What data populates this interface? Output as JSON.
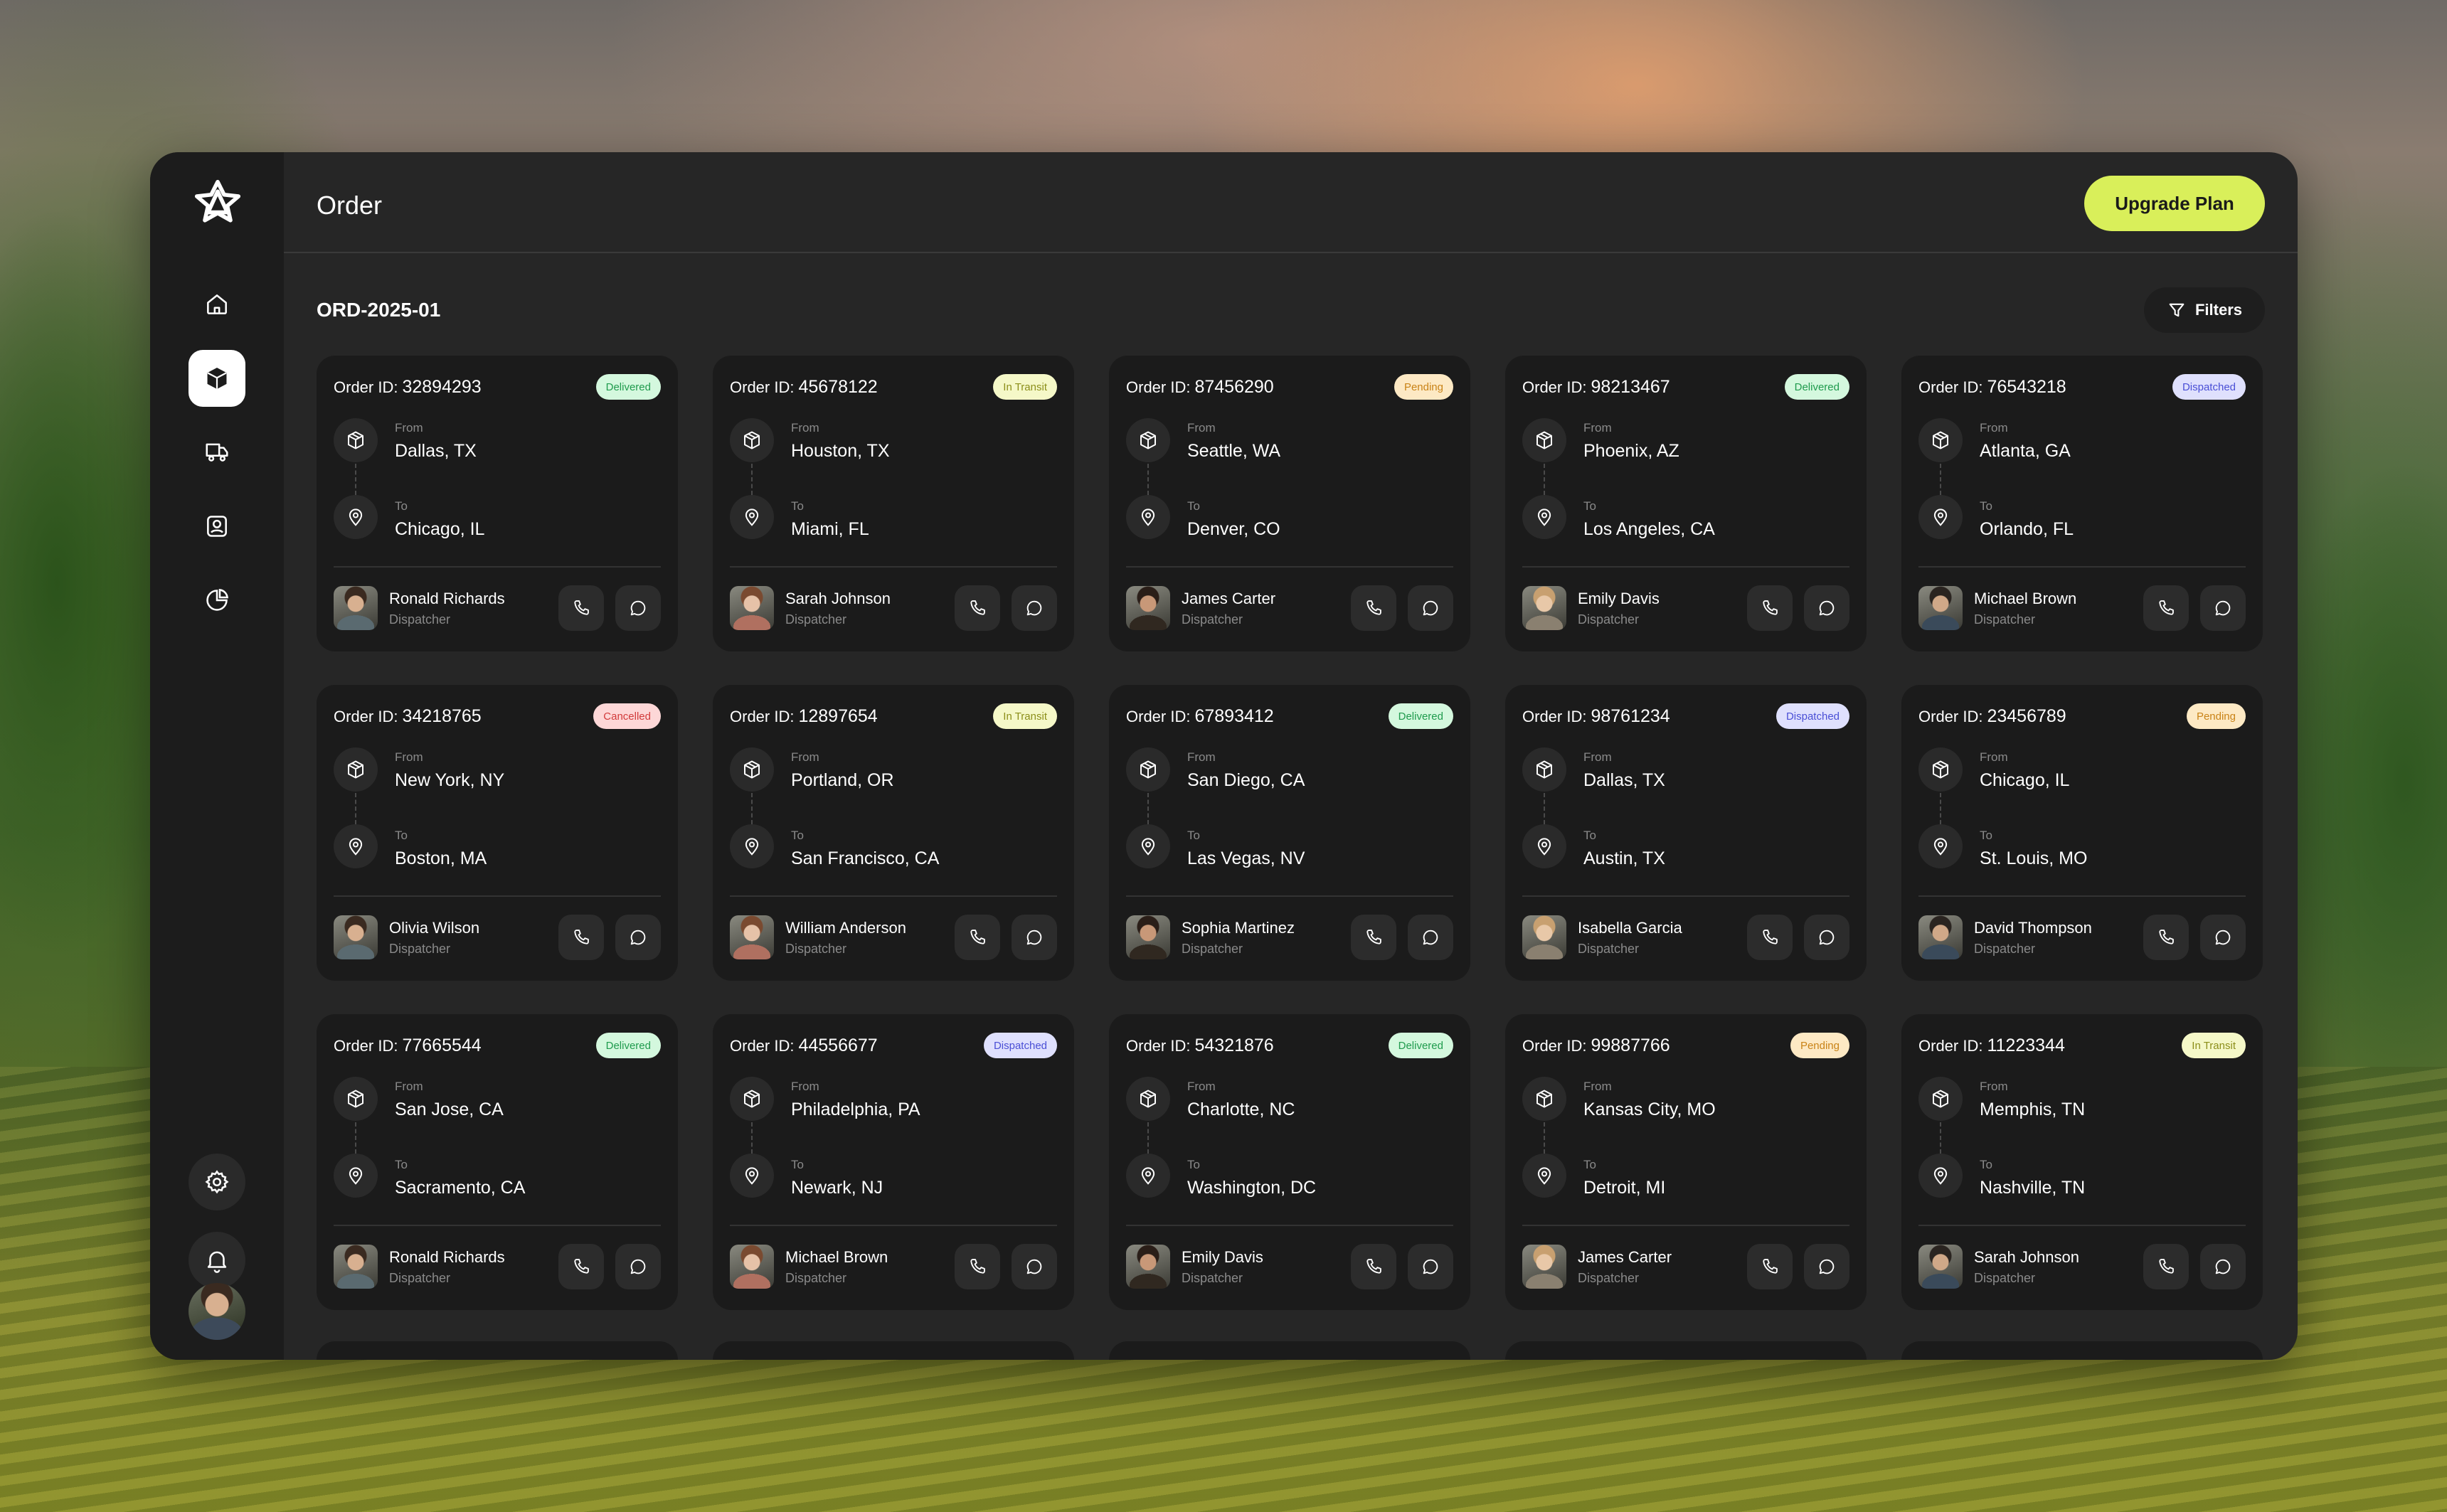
{
  "app": {
    "title": "Order"
  },
  "header": {
    "upgrade_label": "Upgrade Plan"
  },
  "toolbar": {
    "section_title": "ORD-2025-01",
    "filters_label": "Filters"
  },
  "labels": {
    "order_id": "Order ID:",
    "from": "From",
    "to": "To"
  },
  "status_colors": {
    "Delivered": "#1f9b4d",
    "In Transit": "#8c8f1a",
    "Pending": "#c98317",
    "Dispatched": "#4a4fd6",
    "Cancelled": "#d23b3b"
  },
  "orders": [
    {
      "id": "32894293",
      "status": "Delivered",
      "from": "Dallas, TX",
      "to": "Chicago, IL",
      "person": "Ronald Richards",
      "role": "Dispatcher"
    },
    {
      "id": "45678122",
      "status": "In Transit",
      "from": "Houston, TX",
      "to": "Miami, FL",
      "person": "Sarah Johnson",
      "role": "Dispatcher"
    },
    {
      "id": "87456290",
      "status": "Pending",
      "from": "Seattle, WA",
      "to": "Denver, CO",
      "person": "James Carter",
      "role": "Dispatcher"
    },
    {
      "id": "98213467",
      "status": "Delivered",
      "from": "Phoenix, AZ",
      "to": "Los Angeles, CA",
      "person": "Emily Davis",
      "role": "Dispatcher"
    },
    {
      "id": "76543218",
      "status": "Dispatched",
      "from": "Atlanta, GA",
      "to": "Orlando, FL",
      "person": "Michael Brown",
      "role": "Dispatcher"
    },
    {
      "id": "34218765",
      "status": "Cancelled",
      "from": "New York, NY",
      "to": "Boston, MA",
      "person": "Olivia Wilson",
      "role": "Dispatcher"
    },
    {
      "id": "12897654",
      "status": "In Transit",
      "from": "Portland, OR",
      "to": "San Francisco, CA",
      "person": "William Anderson",
      "role": "Dispatcher"
    },
    {
      "id": "67893412",
      "status": "Delivered",
      "from": "San Diego, CA",
      "to": "Las Vegas, NV",
      "person": "Sophia Martinez",
      "role": "Dispatcher"
    },
    {
      "id": "98761234",
      "status": "Dispatched",
      "from": "Dallas, TX",
      "to": "Austin, TX",
      "person": "Isabella Garcia",
      "role": "Dispatcher"
    },
    {
      "id": "23456789",
      "status": "Pending",
      "from": "Chicago, IL",
      "to": "St. Louis, MO",
      "person": "David Thompson",
      "role": "Dispatcher"
    },
    {
      "id": "77665544",
      "status": "Delivered",
      "from": "San Jose, CA",
      "to": "Sacramento, CA",
      "person": "Ronald Richards",
      "role": "Dispatcher"
    },
    {
      "id": "44556677",
      "status": "Dispatched",
      "from": "Philadelphia, PA",
      "to": "Newark, NJ",
      "person": "Michael Brown",
      "role": "Dispatcher"
    },
    {
      "id": "54321876",
      "status": "Delivered",
      "from": "Charlotte, NC",
      "to": "Washington, DC",
      "person": "Emily Davis",
      "role": "Dispatcher"
    },
    {
      "id": "99887766",
      "status": "Pending",
      "from": "Kansas City, MO",
      "to": "Detroit, MI",
      "person": "James Carter",
      "role": "Dispatcher"
    },
    {
      "id": "11223344",
      "status": "In Transit",
      "from": "Memphis, TN",
      "to": "Nashville, TN",
      "person": "Sarah Johnson",
      "role": "Dispatcher"
    }
  ],
  "sidebar": {
    "items": [
      {
        "icon": "home-icon",
        "active": false
      },
      {
        "icon": "box-icon",
        "active": true
      },
      {
        "icon": "truck-icon",
        "active": false
      },
      {
        "icon": "contact-icon",
        "active": false
      },
      {
        "icon": "pie-chart-icon",
        "active": false
      }
    ],
    "bottom": [
      "gear-icon",
      "bell-icon"
    ]
  }
}
